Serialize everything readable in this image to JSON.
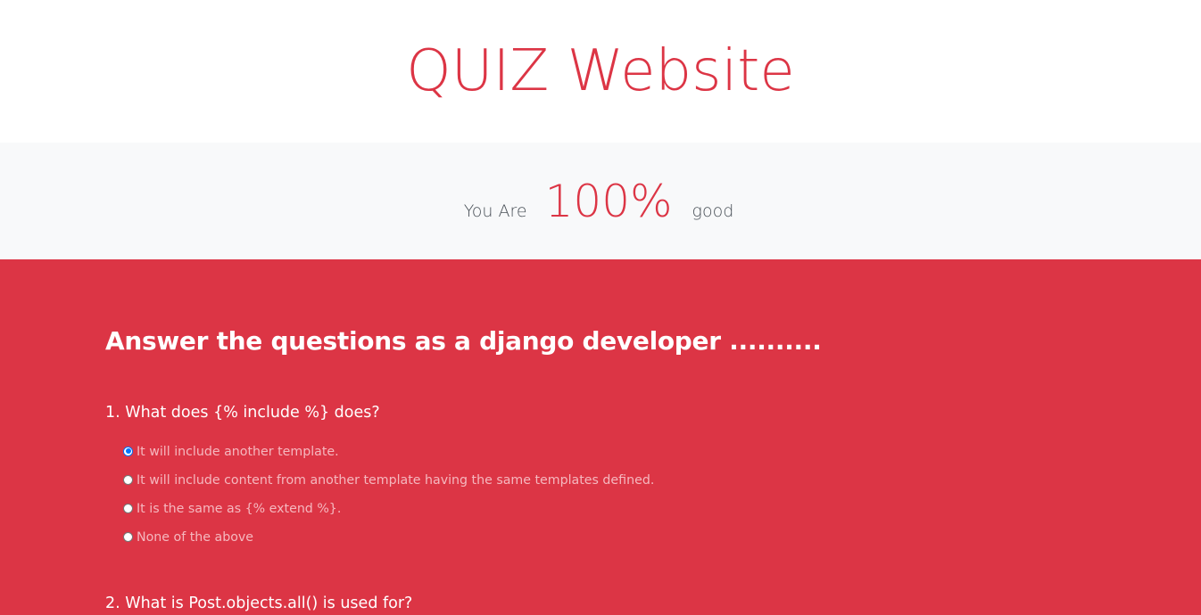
{
  "header": {
    "title": "QUIZ Website"
  },
  "score": {
    "prefix": "You Are",
    "value": "100%",
    "suffix": "good"
  },
  "quiz": {
    "heading": "Answer the questions as a django developer ..........",
    "questions": [
      {
        "text": "1. What does {% include %} does?",
        "options": [
          {
            "label": "It will include another template.",
            "selected": true
          },
          {
            "label": "It will include content from another template having the same templates defined.",
            "selected": false
          },
          {
            "label": "It is the same as {% extend %}.",
            "selected": false
          },
          {
            "label": "None of the above",
            "selected": false
          }
        ]
      },
      {
        "text": "2. What is Post.objects.all() is used for?"
      }
    ]
  },
  "colors": {
    "accent": "#dc3545",
    "band": "#f8f9fa",
    "radio_checked": "#0075ff"
  }
}
